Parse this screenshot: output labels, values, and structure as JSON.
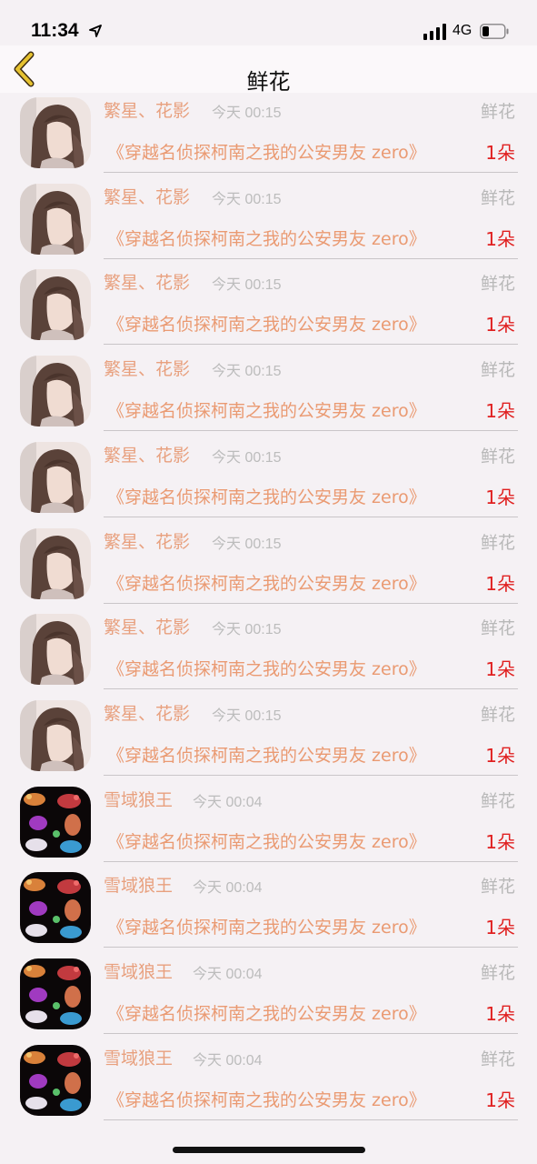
{
  "status_bar": {
    "time": "11:34",
    "network": "4G"
  },
  "nav": {
    "title": "鲜花"
  },
  "items": [
    {
      "sender": "",
      "time": "",
      "gift": "",
      "book": "《穿越名侦探柯南之我的公安男友 zero》",
      "count": "1朵",
      "avatar": "girl"
    },
    {
      "sender": "繁星、花影",
      "time": "今天 00:15",
      "gift": "鲜花",
      "book": "《穿越名侦探柯南之我的公安男友 zero》",
      "count": "1朵",
      "avatar": "girl"
    },
    {
      "sender": "繁星、花影",
      "time": "今天 00:15",
      "gift": "鲜花",
      "book": "《穿越名侦探柯南之我的公安男友 zero》",
      "count": "1朵",
      "avatar": "girl"
    },
    {
      "sender": "繁星、花影",
      "time": "今天 00:15",
      "gift": "鲜花",
      "book": "《穿越名侦探柯南之我的公安男友 zero》",
      "count": "1朵",
      "avatar": "girl"
    },
    {
      "sender": "繁星、花影",
      "time": "今天 00:15",
      "gift": "鲜花",
      "book": "《穿越名侦探柯南之我的公安男友 zero》",
      "count": "1朵",
      "avatar": "girl"
    },
    {
      "sender": "繁星、花影",
      "time": "今天 00:15",
      "gift": "鲜花",
      "book": "《穿越名侦探柯南之我的公安男友 zero》",
      "count": "1朵",
      "avatar": "girl"
    },
    {
      "sender": "繁星、花影",
      "time": "今天 00:15",
      "gift": "鲜花",
      "book": "《穿越名侦探柯南之我的公安男友 zero》",
      "count": "1朵",
      "avatar": "girl"
    },
    {
      "sender": "繁星、花影",
      "time": "今天 00:15",
      "gift": "鲜花",
      "book": "《穿越名侦探柯南之我的公安男友 zero》",
      "count": "1朵",
      "avatar": "girl"
    },
    {
      "sender": "繁星、花影",
      "time": "今天 00:15",
      "gift": "鲜花",
      "book": "《穿越名侦探柯南之我的公安男友 zero》",
      "count": "1朵",
      "avatar": "girl"
    },
    {
      "sender": "雪域狼王",
      "time": "今天 00:04",
      "gift": "鲜花",
      "book": "《穿越名侦探柯南之我的公安男友 zero》",
      "count": "1朵",
      "avatar": "wolves"
    },
    {
      "sender": "雪域狼王",
      "time": "今天 00:04",
      "gift": "鲜花",
      "book": "《穿越名侦探柯南之我的公安男友 zero》",
      "count": "1朵",
      "avatar": "wolves"
    },
    {
      "sender": "雪域狼王",
      "time": "今天 00:04",
      "gift": "鲜花",
      "book": "《穿越名侦探柯南之我的公安男友 zero》",
      "count": "1朵",
      "avatar": "wolves"
    },
    {
      "sender": "雪域狼王",
      "time": "今天 00:04",
      "gift": "鲜花",
      "book": "《穿越名侦探柯南之我的公安男友 zero》",
      "count": "1朵",
      "avatar": "wolves"
    }
  ]
}
